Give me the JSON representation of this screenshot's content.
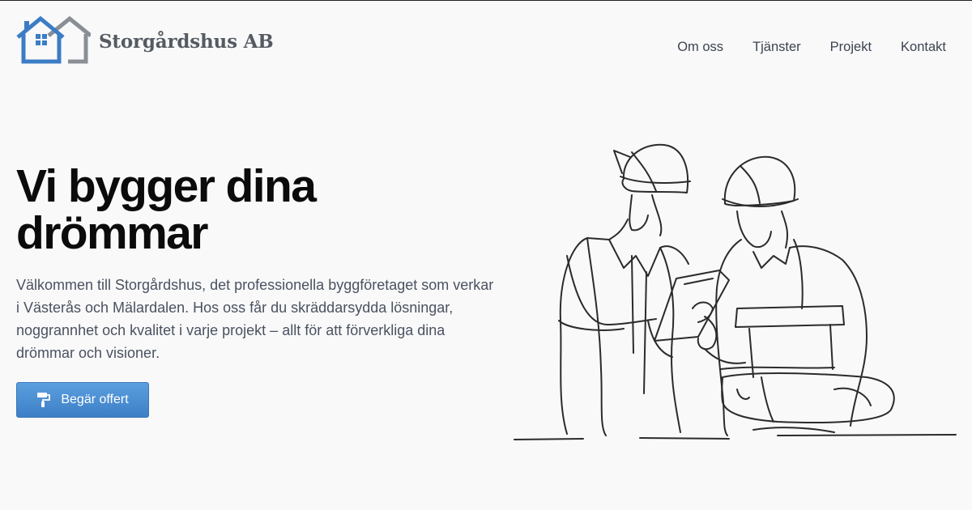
{
  "brand": {
    "name": "Storgårdshus AB",
    "logo_icon": "house-logo-icon",
    "colors": {
      "primary_house": "#3b7dc4",
      "secondary_house": "#8a8f96"
    }
  },
  "nav": {
    "items": [
      {
        "label": "Om oss"
      },
      {
        "label": "Tjänster"
      },
      {
        "label": "Projekt"
      },
      {
        "label": "Kontakt"
      }
    ]
  },
  "hero": {
    "title_line1": "Vi bygger dina",
    "title_line2": "drömmar",
    "description": "Välkommen till Storgårdshus, det professionella byggföretaget som verkar i Västerås och Mälardalen. Hos oss får du skräddarsydda lösningar, noggrannhet och kvalitet i varje projekt – allt för att förverkliga dina drömmar och visioner.",
    "cta": {
      "label": "Begär offert",
      "icon": "paint-roller-icon",
      "color": "#4a8ed4"
    },
    "illustration_icon": "construction-workers-illustration"
  }
}
